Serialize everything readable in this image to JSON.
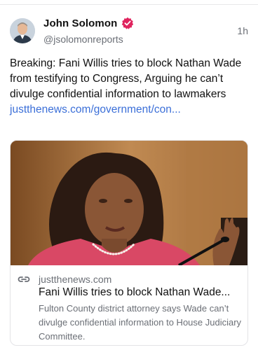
{
  "author": {
    "name": "John Solomon",
    "handle": "@jsolomonreports",
    "time": "1h"
  },
  "post": {
    "text": "Breaking: Fani Willis tries to block Nathan Wade from testifying to Congress, Arguing he can’t divulge confidential information to lawmakers ",
    "link": "justthenews.com/government/con..."
  },
  "card": {
    "domain": "justthenews.com",
    "title": "Fani Willis tries to block Nathan Wade...",
    "description": "Fulton County district attorney says Wade can’t divulge confidential information to House Judiciary Committee."
  },
  "icons": {
    "verified": "verified-badge-icon",
    "link": "link-icon"
  },
  "colors": {
    "link": "#3b6fd8",
    "verified": "#e0245e",
    "secondary_text": "#6b6f76"
  }
}
